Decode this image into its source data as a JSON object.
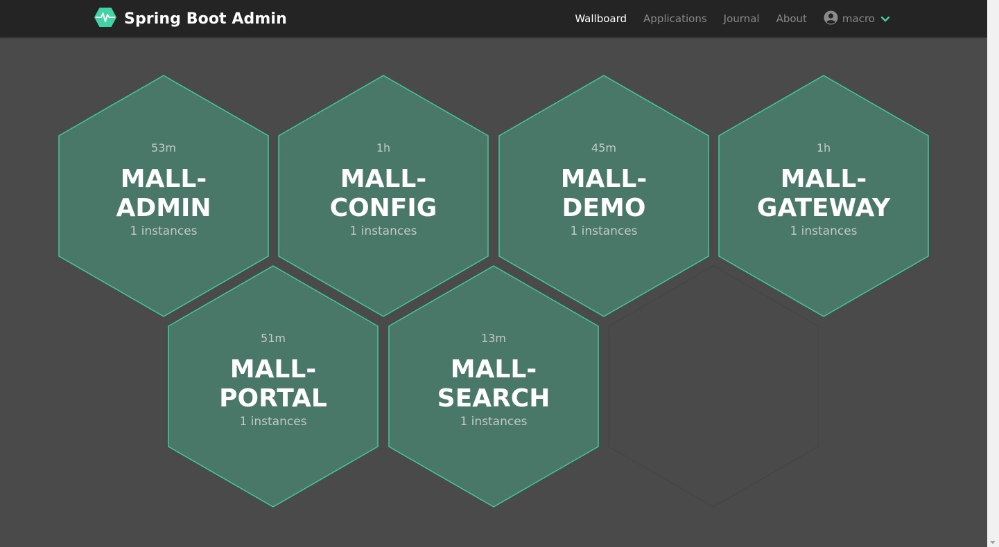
{
  "brand": {
    "title": "Spring Boot Admin",
    "icon": "heartbeat-hexagon-icon"
  },
  "nav": {
    "items": [
      {
        "label": "Wallboard",
        "active": true
      },
      {
        "label": "Applications",
        "active": false
      },
      {
        "label": "Journal",
        "active": false
      },
      {
        "label": "About",
        "active": false
      }
    ],
    "user": {
      "name": "macro",
      "icon": "user-circle-icon",
      "caret": "chevron-down-icon"
    }
  },
  "applications": [
    {
      "uptime": "53m",
      "name_line1": "MALL-",
      "name_line2": "ADMIN",
      "instances": "1 instances",
      "status": "UP"
    },
    {
      "uptime": "1h",
      "name_line1": "MALL-",
      "name_line2": "CONFIG",
      "instances": "1 instances",
      "status": "UP"
    },
    {
      "uptime": "45m",
      "name_line1": "MALL-",
      "name_line2": "DEMO",
      "instances": "1 instances",
      "status": "UP"
    },
    {
      "uptime": "1h",
      "name_line1": "MALL-",
      "name_line2": "GATEWAY",
      "instances": "1 instances",
      "status": "UP"
    },
    {
      "uptime": "51m",
      "name_line1": "MALL-",
      "name_line2": "PORTAL",
      "instances": "1 instances",
      "status": "UP"
    },
    {
      "uptime": "13m",
      "name_line1": "MALL-",
      "name_line2": "SEARCH",
      "instances": "1 instances",
      "status": "UP"
    }
  ],
  "colors": {
    "navbar": "#242424",
    "background": "#4a4a4a",
    "hex_fill": "#4a7868",
    "hex_stroke": "#3ecb96",
    "accent": "#42d3a5"
  }
}
